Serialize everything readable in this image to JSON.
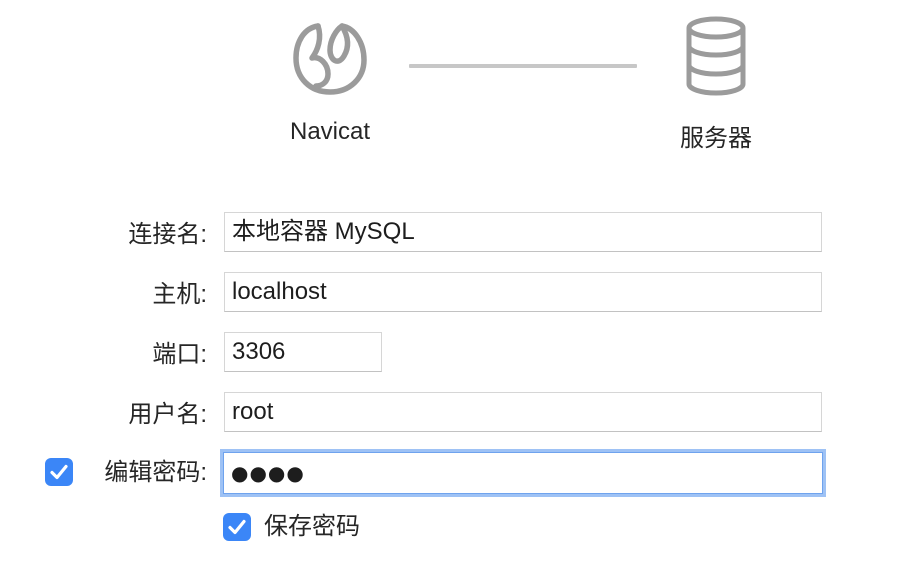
{
  "header": {
    "source_label": "Navicat",
    "target_label": "服务器"
  },
  "form": {
    "connection_name": {
      "label": "连接名:",
      "value": "本地容器 MySQL"
    },
    "host": {
      "label": "主机:",
      "value": "localhost"
    },
    "port": {
      "label": "端口:",
      "value": "3306"
    },
    "username": {
      "label": "用户名:",
      "value": "root"
    },
    "edit_password": {
      "label": "编辑密码:",
      "checked": true,
      "value_masked": "●●●●"
    },
    "save_password": {
      "label": "保存密码",
      "checked": true
    }
  },
  "colors": {
    "accent": "#3b86f7",
    "focus_ring": "#9ec2f5",
    "icon_gray": "#9b9b9b",
    "connector": "#c7c7c7"
  },
  "icons": {
    "source": "navicat-logo-icon",
    "target": "database-server-icon",
    "checkbox": "checkmark-icon"
  }
}
